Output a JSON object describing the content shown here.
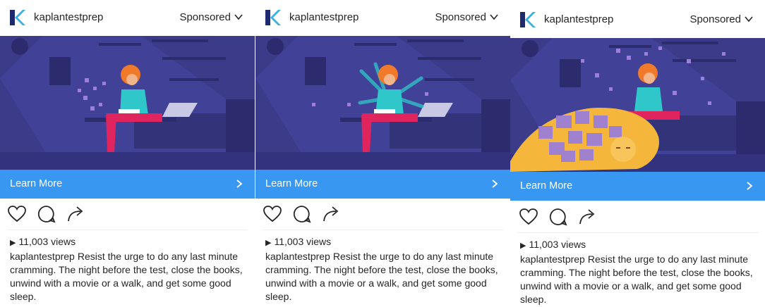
{
  "posts": [
    {
      "username": "kaplantestprep",
      "sponsored": "Sponsored",
      "cta": "Learn More",
      "views": "11,003 views",
      "caption_user": "kaplantestprep",
      "caption_text": "Resist the urge to do any last minute cramming. The night before the test, close the books, unwind with a movie or a walk, and get some good sleep.",
      "scene": "student-reading"
    },
    {
      "username": "kaplantestprep",
      "sponsored": "Sponsored",
      "cta": "Learn More",
      "views": "11,003 views",
      "caption_user": "kaplantestprep",
      "caption_text": "Resist the urge to do any last minute cramming. The night before the test, close the books, unwind with a movie or a walk, and get some good sleep.",
      "scene": "student-multi-arm"
    },
    {
      "username": "kaplantestprep",
      "sponsored": "Sponsored",
      "cta": "Learn More",
      "views": "11,003 views",
      "caption_user": "kaplantestprep",
      "caption_text": "Resist the urge to do any last minute cramming. The night before the test, close the books, unwind with a movie or a walk, and get some good sleep.",
      "scene": "student-with-cat"
    }
  ],
  "colors": {
    "brand_blue": "#3897f0",
    "scene_bg": "#3b3b8a",
    "scene_dark": "#2b2b6e",
    "hair": "#f07a2a",
    "shirt": "#2fc7c9",
    "pants": "#e0245e",
    "cat": "#f5b73b",
    "sticky": "#9b7fd9",
    "logo_dark": "#1e2a6e",
    "logo_light": "#3ab0e2"
  },
  "icons": [
    "kaplan-logo-icon",
    "chevron-down-icon",
    "chevron-right-icon",
    "heart-icon",
    "comment-icon",
    "share-icon",
    "play-icon"
  ]
}
